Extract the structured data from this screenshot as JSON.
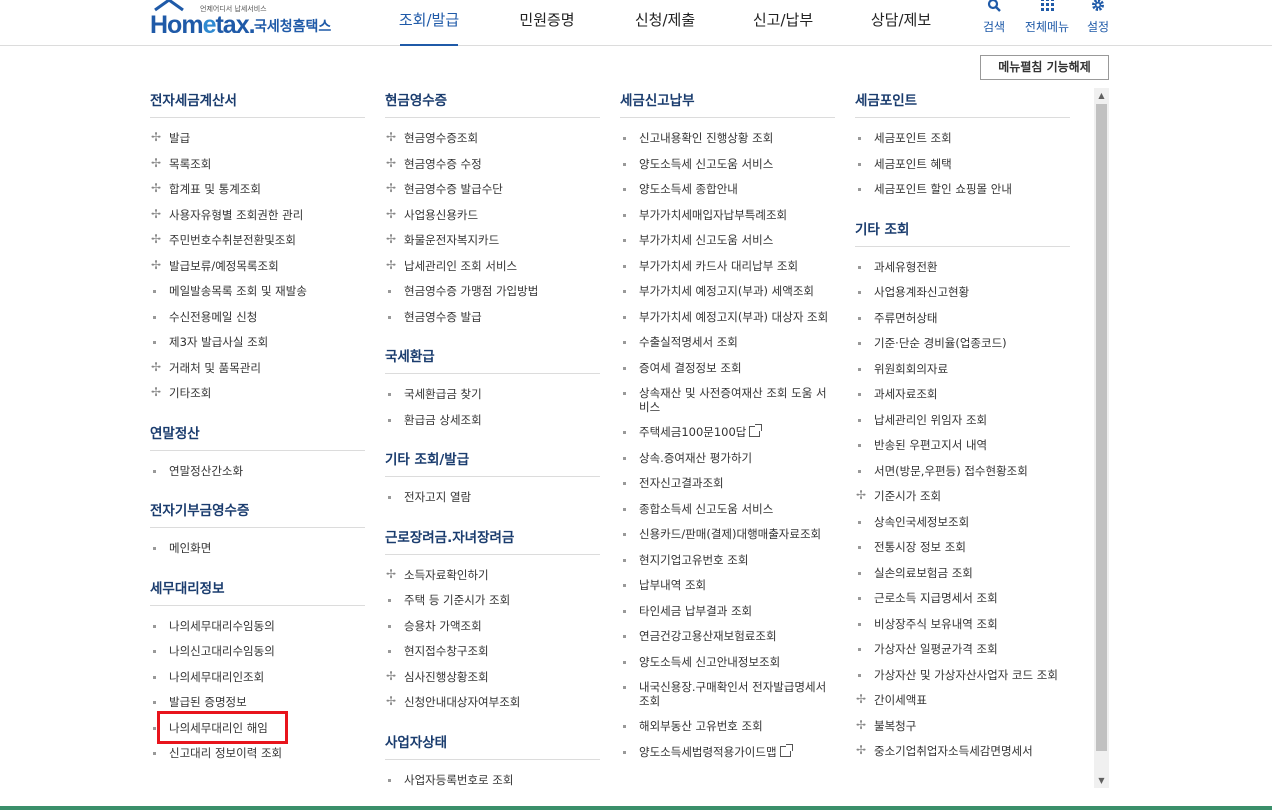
{
  "header": {
    "logo_small": "언제어디서 납세서비스",
    "logo_main_a": "Hom",
    "logo_main_e": "e",
    "logo_main_b": "tax.",
    "logo_kr": "국세청홈택스",
    "nav": [
      {
        "label": "조회/발급",
        "active": true
      },
      {
        "label": "민원증명"
      },
      {
        "label": "신청/제출"
      },
      {
        "label": "신고/납부"
      },
      {
        "label": "상담/제보"
      }
    ],
    "util": {
      "search": "검색",
      "all_menu": "전체메뉴",
      "settings": "설정"
    }
  },
  "collapse_button": "메뉴펼침 기능해제",
  "columns": [
    [
      {
        "title": "전자세금계산서",
        "items": [
          {
            "label": "발급",
            "mark": "plus"
          },
          {
            "label": "목록조회",
            "mark": "plus"
          },
          {
            "label": "합계표 및 통계조회",
            "mark": "plus"
          },
          {
            "label": "사용자유형별 조회권한 관리",
            "mark": "plus"
          },
          {
            "label": "주민번호수취분전환및조회",
            "mark": "plus"
          },
          {
            "label": "발급보류/예정목록조회",
            "mark": "plus"
          },
          {
            "label": "메일발송목록 조회 및 재발송",
            "mark": "dot"
          },
          {
            "label": "수신전용메일 신청",
            "mark": "dot"
          },
          {
            "label": "제3자 발급사실 조회",
            "mark": "dot"
          },
          {
            "label": "거래처 및 품목관리",
            "mark": "plus"
          },
          {
            "label": "기타조회",
            "mark": "plus"
          }
        ]
      },
      {
        "title": "연말정산",
        "items": [
          {
            "label": "연말정산간소화",
            "mark": "dot"
          }
        ]
      },
      {
        "title": "전자기부금영수증",
        "items": [
          {
            "label": "메인화면",
            "mark": "dot"
          }
        ]
      },
      {
        "title": "세무대리정보",
        "items": [
          {
            "label": "나의세무대리수임동의",
            "mark": "dot"
          },
          {
            "label": "나의신고대리수임동의",
            "mark": "dot"
          },
          {
            "label": "나의세무대리인조회",
            "mark": "dot"
          },
          {
            "label": "발급된 증명정보",
            "mark": "dot"
          },
          {
            "label": "나의세무대리인 해임",
            "mark": "dot"
          },
          {
            "label": "신고대리 정보이력 조회",
            "mark": "dot"
          }
        ]
      }
    ],
    [
      {
        "title": "현금영수증",
        "items": [
          {
            "label": "현금영수증조회",
            "mark": "plus"
          },
          {
            "label": "현금영수증 수정",
            "mark": "plus"
          },
          {
            "label": "현금영수증 발급수단",
            "mark": "plus"
          },
          {
            "label": "사업용신용카드",
            "mark": "plus"
          },
          {
            "label": "화물운전자복지카드",
            "mark": "plus"
          },
          {
            "label": "납세관리인 조회 서비스",
            "mark": "plus"
          },
          {
            "label": "현금영수증 가맹점 가입방법",
            "mark": "dot"
          },
          {
            "label": "현금영수증 발급",
            "mark": "dot"
          }
        ]
      },
      {
        "title": "국세환급",
        "items": [
          {
            "label": "국세환급금 찾기",
            "mark": "dot"
          },
          {
            "label": "환급금 상세조회",
            "mark": "dot"
          }
        ]
      },
      {
        "title": "기타 조회/발급",
        "items": [
          {
            "label": "전자고지 열람",
            "mark": "dot"
          }
        ]
      },
      {
        "title": "근로장려금.자녀장려금",
        "items": [
          {
            "label": "소득자료확인하기",
            "mark": "plus"
          },
          {
            "label": "주택 등 기준시가 조회",
            "mark": "dot"
          },
          {
            "label": "승용차 가액조회",
            "mark": "dot"
          },
          {
            "label": "현지접수창구조회",
            "mark": "dot"
          },
          {
            "label": "심사진행상황조회",
            "mark": "plus"
          },
          {
            "label": "신청안내대상자여부조회",
            "mark": "plus"
          }
        ]
      },
      {
        "title": "사업자상태",
        "items": [
          {
            "label": "사업자등록번호로 조회",
            "mark": "dot"
          }
        ]
      }
    ],
    [
      {
        "title": "세금신고납부",
        "items": [
          {
            "label": "신고내용확인 진행상황 조회",
            "mark": "dot"
          },
          {
            "label": "양도소득세 신고도움 서비스",
            "mark": "dot"
          },
          {
            "label": "양도소득세 종합안내",
            "mark": "dot"
          },
          {
            "label": "부가가치세매입자납부특례조회",
            "mark": "dot"
          },
          {
            "label": "부가가치세 신고도움 서비스",
            "mark": "dot"
          },
          {
            "label": "부가가치세 카드사 대리납부 조회",
            "mark": "dot"
          },
          {
            "label": "부가가치세 예정고지(부과) 세액조회",
            "mark": "dot"
          },
          {
            "label": "부가가치세 예정고지(부과) 대상자 조회",
            "mark": "dot"
          },
          {
            "label": "수출실적명세서 조회",
            "mark": "dot"
          },
          {
            "label": "증여세 결정정보 조회",
            "mark": "dot"
          },
          {
            "label": "상속재산 및 사전증여재산 조회 도움 서비스",
            "mark": "dot"
          },
          {
            "label": "주택세금100문100답",
            "mark": "dot",
            "ext": true
          },
          {
            "label": "상속.증여재산 평가하기",
            "mark": "dot"
          },
          {
            "label": "전자신고결과조회",
            "mark": "dot"
          },
          {
            "label": "종합소득세 신고도움 서비스",
            "mark": "dot"
          },
          {
            "label": "신용카드/판매(결제)대행매출자료조회",
            "mark": "dot"
          },
          {
            "label": "현지기업고유번호 조회",
            "mark": "dot"
          },
          {
            "label": "납부내역 조회",
            "mark": "dot"
          },
          {
            "label": "타인세금 납부결과 조회",
            "mark": "dot"
          },
          {
            "label": "연금건강고용산재보험료조회",
            "mark": "dot"
          },
          {
            "label": "양도소득세 신고안내정보조회",
            "mark": "dot"
          },
          {
            "label": "내국신용장.구매확인서 전자발급명세서 조회",
            "mark": "dot"
          },
          {
            "label": "해외부동산 고유번호 조회",
            "mark": "dot"
          },
          {
            "label": "양도소득세법령적용가이드맵",
            "mark": "dot",
            "ext": true
          }
        ]
      }
    ],
    [
      {
        "title": "세금포인트",
        "items": [
          {
            "label": "세금포인트 조회",
            "mark": "dot"
          },
          {
            "label": "세금포인트 혜택",
            "mark": "dot"
          },
          {
            "label": "세금포인트 할인 쇼핑몰 안내",
            "mark": "dot"
          }
        ]
      },
      {
        "title": "기타 조회",
        "items": [
          {
            "label": "과세유형전환",
            "mark": "dot"
          },
          {
            "label": "사업용계좌신고현황",
            "mark": "dot"
          },
          {
            "label": "주류면허상태",
            "mark": "dot"
          },
          {
            "label": "기준·단순 경비율(업종코드)",
            "mark": "dot"
          },
          {
            "label": "위원회회의자료",
            "mark": "dot"
          },
          {
            "label": "과세자료조회",
            "mark": "dot"
          },
          {
            "label": "납세관리인 위임자 조회",
            "mark": "dot"
          },
          {
            "label": "반송된 우편고지서 내역",
            "mark": "dot"
          },
          {
            "label": "서면(방문,우편등) 접수현황조회",
            "mark": "dot"
          },
          {
            "label": "기준시가 조회",
            "mark": "plus"
          },
          {
            "label": "상속인국세정보조회",
            "mark": "dot"
          },
          {
            "label": "전통시장 정보 조회",
            "mark": "dot"
          },
          {
            "label": "실손의료보험금 조회",
            "mark": "dot"
          },
          {
            "label": "근로소득 지급명세서 조회",
            "mark": "dot"
          },
          {
            "label": "비상장주식 보유내역 조회",
            "mark": "dot"
          },
          {
            "label": "가상자산 일평균가격 조회",
            "mark": "dot"
          },
          {
            "label": "가상자산 및 가상자산사업자 코드 조회",
            "mark": "dot"
          },
          {
            "label": "간이세액표",
            "mark": "plus"
          },
          {
            "label": "불복청구",
            "mark": "plus"
          },
          {
            "label": "중소기업취업자소득세감면명세서",
            "mark": "plus"
          }
        ]
      }
    ]
  ],
  "highlight_color": "#e8141c",
  "brand_color": "#1f5aa8"
}
